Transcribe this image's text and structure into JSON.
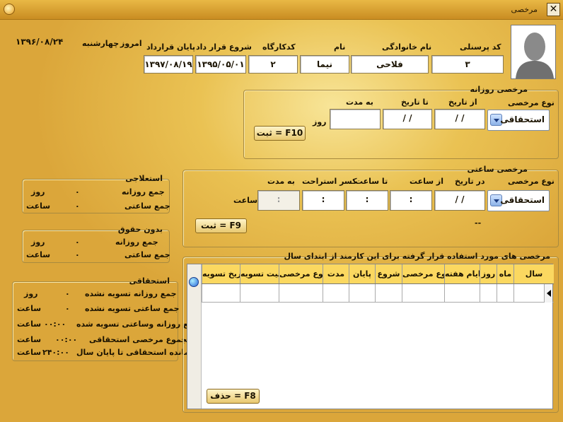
{
  "window": {
    "title": "مرخصی",
    "close": "✕"
  },
  "header": {
    "date": "۱۳۹۶/۰۸/۲۴",
    "today_label": "امروز",
    "weekday": "چهارشنبه",
    "personnel_code_label": "کد پرسنلی",
    "personnel_code": "۳",
    "last_name_label": "نام خانوادگی",
    "last_name": "فلاحی",
    "first_name_label": "نام",
    "first_name": "نیما",
    "workplace_code_label": "کدکارگاه",
    "workplace_code": "۲",
    "contract_start_label": "شروع قرار داد",
    "contract_start": "۱۳۹۵/۰۵/۰۱",
    "contract_end_label": "پایان قرارداد",
    "contract_end": "۱۳۹۷/۰۸/۱۹"
  },
  "daily": {
    "title": "مرخصی روزانه",
    "type_label": "نوع مرخصی",
    "type_value": "استحقاقی",
    "from_label": "از تاریخ",
    "from_value": "/ /",
    "to_label": "تا تاریخ",
    "to_value": "/ /",
    "duration_label": "به مدت",
    "duration_value": "",
    "unit": "روز",
    "save": "ثبت = F10"
  },
  "hourly": {
    "title": "مرخصی ساعتی",
    "type_label": "نوع مرخصی",
    "type_value": "استحقاقی",
    "date_label": "در تاریخ",
    "date_value": "/ /",
    "from_label": "از ساعت",
    "from_value": ":",
    "to_label": "تا ساعت",
    "to_value": ":",
    "break_label": "کسر استراحت",
    "break_value": ":",
    "duration_label": "به مدت",
    "duration_value": ":",
    "unit": "ساعت",
    "save": "ثبت = F9",
    "dash": "--"
  },
  "sick": {
    "title": "استعلاجی",
    "daily_label": "جمع روزانه",
    "daily_value": "۰",
    "daily_unit": "روز",
    "hourly_label": "جمع ساعتی",
    "hourly_value": "۰",
    "hourly_unit": "ساعت"
  },
  "unpaid": {
    "title": "بدون حقوق",
    "daily_label": "جمع روزانه",
    "daily_value": "۰",
    "daily_unit": "روز",
    "hourly_label": "جمع ساعتی",
    "hourly_value": "۰",
    "hourly_unit": "ساعت"
  },
  "entitled": {
    "title": "استحقاقی",
    "r1_label": "جمع روزانه تسویه نشده",
    "r1_value": "۰",
    "r1_unit": "روز",
    "r2_label": "جمع ساعتی تسویه نشده",
    "r2_value": "۰",
    "r2_unit": "ساعت",
    "r3_label": "جمع روزانه وساعتی تسویه شده",
    "r3_value": "۰۰:۰۰",
    "r3_unit": "ساعت",
    "r4_label": "مجموع مرخصی استحقاقی",
    "r4_value": "۰۰:۰۰",
    "r4_unit": "ساعت",
    "r5_label": "باقیمانده استحقاقی تا پایان سال",
    "r5_value": "۲۴۰:۰۰",
    "r5_unit": "ساعت"
  },
  "table": {
    "title": "مرخصی های مورد استفاده قرار گرفته برای این کارمند از ابتدای سال",
    "columns": [
      "سال",
      "ماه",
      "روز",
      "ایام هفته",
      "نوع مرخصی",
      "شروع",
      "پایان",
      "مدت",
      "نوع مرخصی",
      "وضعیت تسویه",
      "تاریخ تسویه"
    ],
    "delete": "حذف = F8"
  }
}
